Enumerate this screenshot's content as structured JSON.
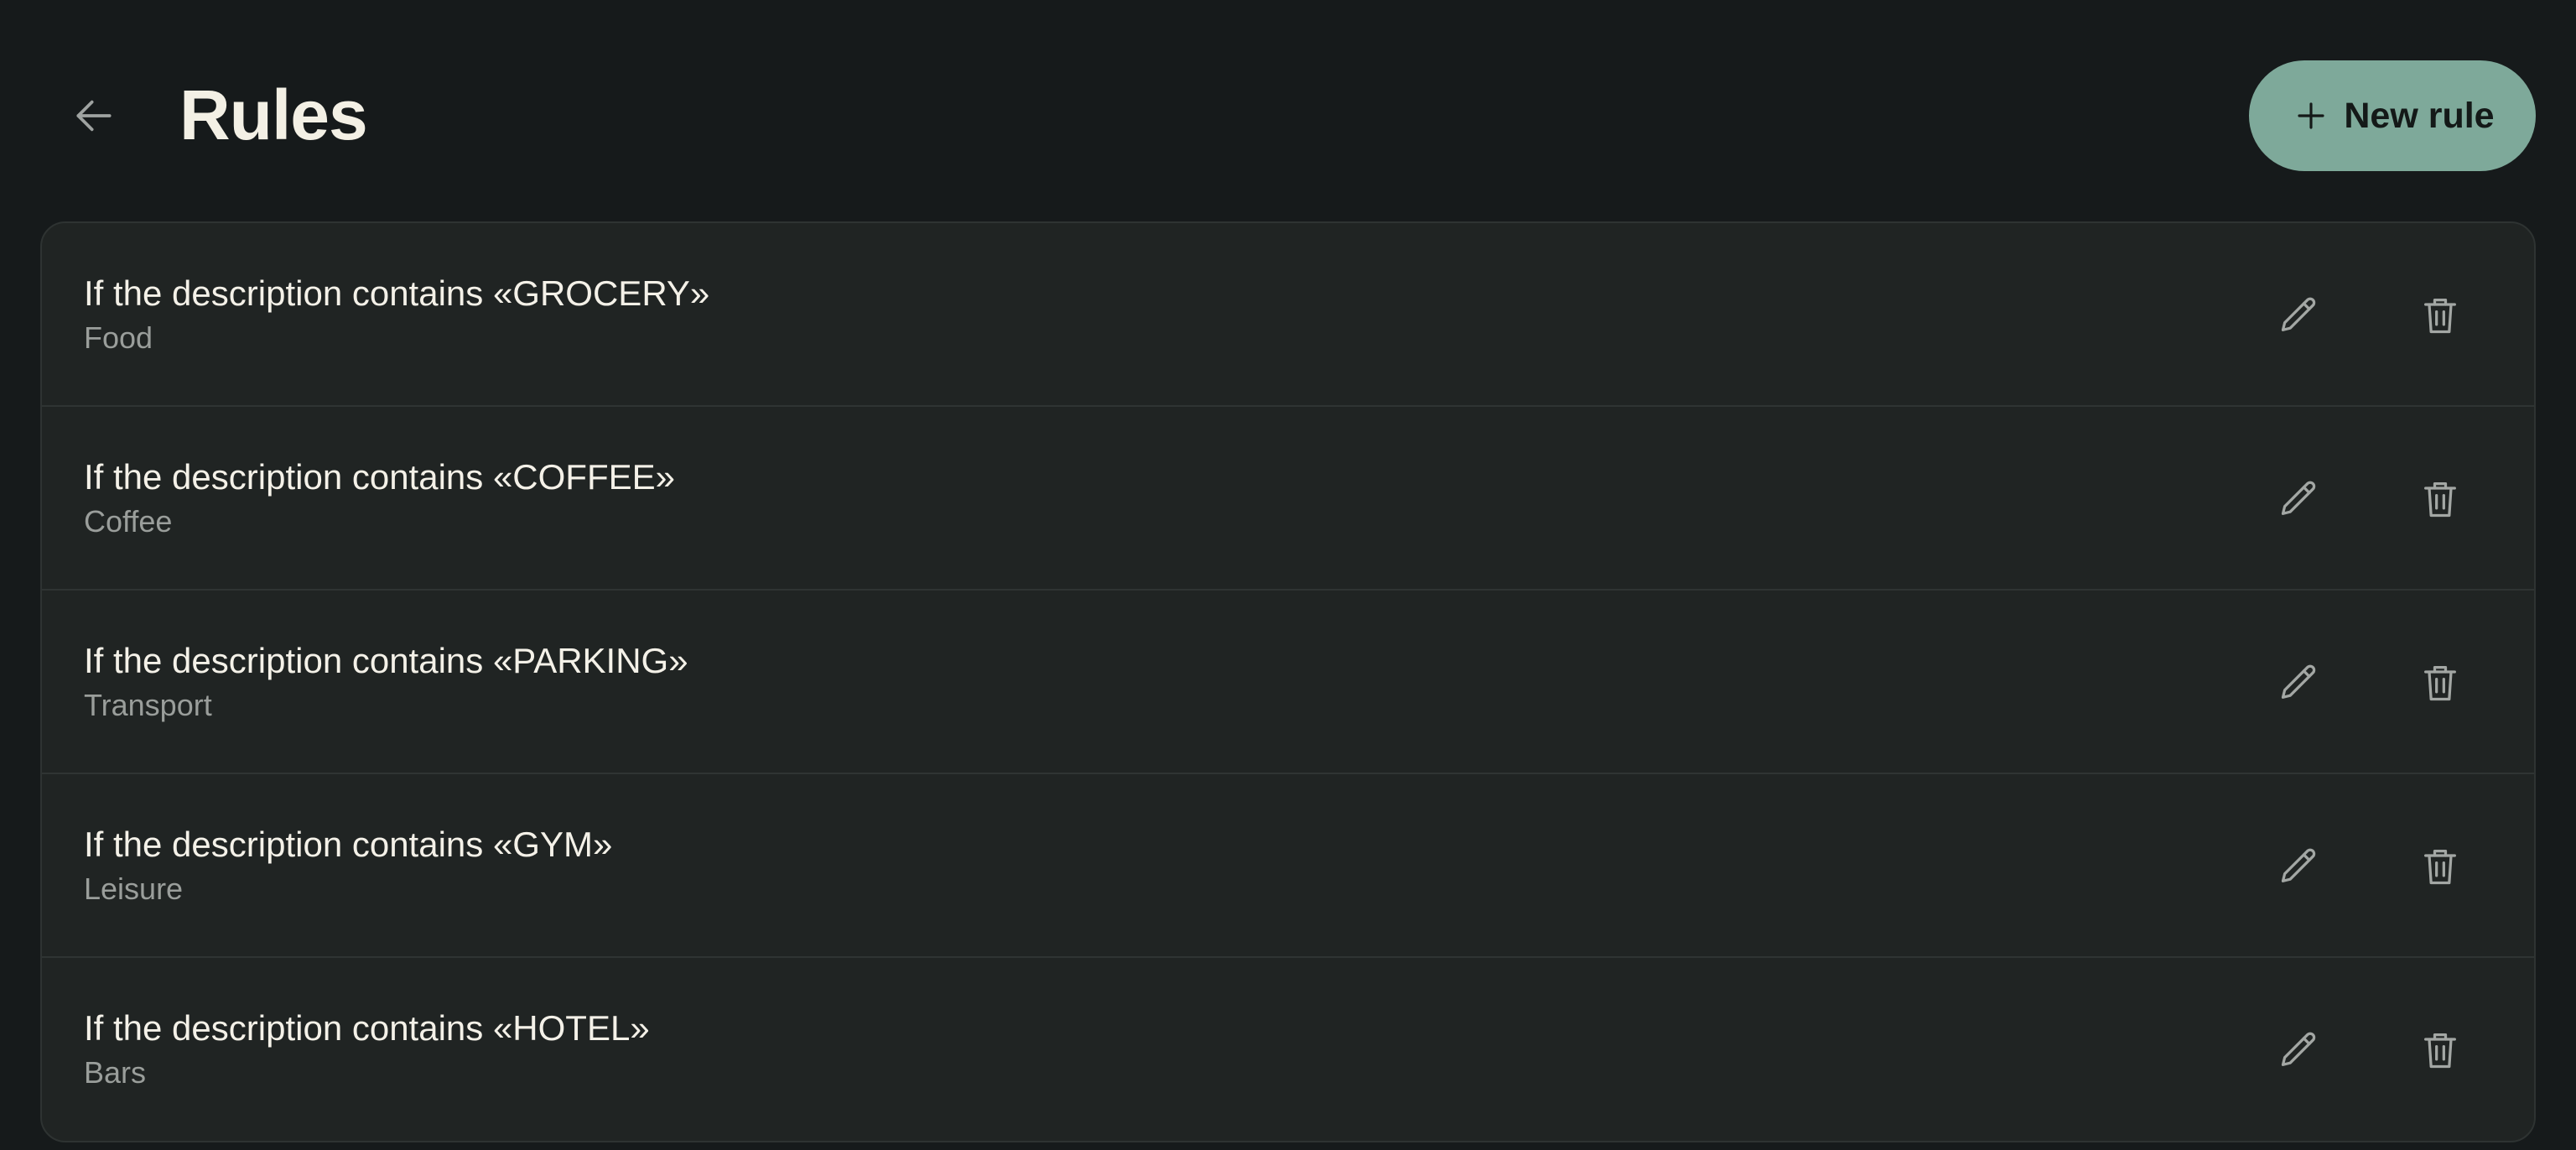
{
  "header": {
    "back_icon": "arrow-left-icon",
    "title": "Rules",
    "new_rule_icon": "plus-icon",
    "new_rule_label": "New rule"
  },
  "colors": {
    "background": "#161a1b",
    "card": "#202423",
    "accent": "#7ea99a",
    "text_primary": "#f4f1e8",
    "text_secondary": "#9a9e9b"
  },
  "rules": [
    {
      "condition": "If the description contains «GROCERY»",
      "category": "Food",
      "edit_icon": "pencil-icon",
      "delete_icon": "trash-icon"
    },
    {
      "condition": "If the description contains «COFFEE»",
      "category": "Coffee",
      "edit_icon": "pencil-icon",
      "delete_icon": "trash-icon"
    },
    {
      "condition": "If the description contains «PARKING»",
      "category": "Transport",
      "edit_icon": "pencil-icon",
      "delete_icon": "trash-icon"
    },
    {
      "condition": "If the description contains «GYM»",
      "category": "Leisure",
      "edit_icon": "pencil-icon",
      "delete_icon": "trash-icon"
    },
    {
      "condition": "If the description contains «HOTEL»",
      "category": "Bars",
      "edit_icon": "pencil-icon",
      "delete_icon": "trash-icon"
    }
  ]
}
